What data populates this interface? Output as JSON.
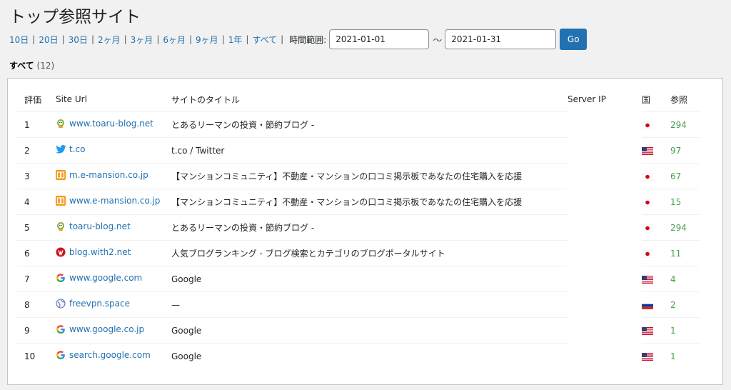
{
  "page": {
    "title": "トップ参照サイト"
  },
  "filters": {
    "links": [
      "10日",
      "20日",
      "30日",
      "2ヶ月",
      "3ヶ月",
      "6ヶ月",
      "9ヶ月",
      "1年",
      "すべて"
    ],
    "range_label": "時間範囲:",
    "from": "2021-01-01",
    "tilde": "～",
    "to": "2021-01-31",
    "go": "Go"
  },
  "summary": {
    "label": "すべて",
    "count": "(12)"
  },
  "table": {
    "headers": {
      "rank": "評価",
      "url": "Site Url",
      "title": "サイトのタイトル",
      "ip": "Server IP",
      "country": "国",
      "refs": "参照"
    },
    "rows": [
      {
        "rank": "1",
        "url": "www.toaru-blog.net",
        "title": "とあるリーマンの投資・節約ブログ -",
        "icon": "toaru-blog-icon",
        "flag": "jp",
        "refs": "294"
      },
      {
        "rank": "2",
        "url": "t.co",
        "title": "t.co / Twitter",
        "icon": "twitter-icon",
        "flag": "us",
        "refs": "97"
      },
      {
        "rank": "3",
        "url": "m.e-mansion.co.jp",
        "title": "【マンションコミュニティ】不動産・マンションの口コミ掲示板であなたの住宅購入を応援",
        "icon": "e-mansion-icon",
        "flag": "jp",
        "refs": "67"
      },
      {
        "rank": "4",
        "url": "www.e-mansion.co.jp",
        "title": "【マンションコミュニティ】不動産・マンションの口コミ掲示板であなたの住宅購入を応援",
        "icon": "e-mansion-icon",
        "flag": "jp",
        "refs": "15"
      },
      {
        "rank": "5",
        "url": "toaru-blog.net",
        "title": "とあるリーマンの投資・節約ブログ -",
        "icon": "toaru-blog-icon",
        "flag": "jp",
        "refs": "294"
      },
      {
        "rank": "6",
        "url": "blog.with2.net",
        "title": "人気ブログランキング - ブログ検索とカテゴリのブログポータルサイト",
        "icon": "with2-icon",
        "flag": "jp",
        "refs": "11"
      },
      {
        "rank": "7",
        "url": "www.google.com",
        "title": "Google",
        "icon": "google-icon",
        "flag": "us",
        "refs": "4"
      },
      {
        "rank": "8",
        "url": "freevpn.space",
        "title": "—",
        "icon": "globe-icon",
        "flag": "ru",
        "refs": "2"
      },
      {
        "rank": "9",
        "url": "www.google.co.jp",
        "title": "Google",
        "icon": "google-icon",
        "flag": "us",
        "refs": "1"
      },
      {
        "rank": "10",
        "url": "search.google.com",
        "title": "Google",
        "icon": "google-icon",
        "flag": "us",
        "refs": "1"
      }
    ]
  },
  "colors": {
    "link": "#2271b1",
    "refs": "#46a04b",
    "button": "#2271b1"
  }
}
